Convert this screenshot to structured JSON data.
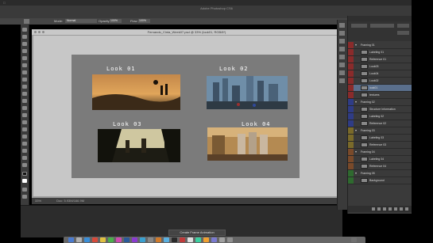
{
  "window_title": "Adobe Photoshop CS6",
  "document_tab": "Fernando_Cinta_Week07.psd @ 33% (look01, RGB/8*)",
  "options_bar": {
    "mode_label": "Mode:",
    "mode_value": "Normal",
    "opacity_label": "Opacity:",
    "opacity_value": "100%",
    "flow_label": "Flow:",
    "flow_value": "100%"
  },
  "status": {
    "zoom": "33%",
    "doc_size": "Doc: 5.93M/166.9M"
  },
  "artboard": {
    "looks": [
      "Look 01",
      "Look 02",
      "Look 03",
      "Look 04"
    ]
  },
  "panels": {
    "tabs": [
      "Layers",
      "Channels"
    ]
  },
  "layers": [
    {
      "name": "Framing 01",
      "group": true,
      "color": "#8a2b2b"
    },
    {
      "name": "Labeling 01",
      "group": false,
      "color": "#8a2b2b"
    },
    {
      "name": "Reference 01",
      "group": false,
      "color": "#8a2b2b"
    },
    {
      "name": "Look03",
      "group": false,
      "color": "#8a2b2b"
    },
    {
      "name": "Look04",
      "group": false,
      "color": "#8a2b2b"
    },
    {
      "name": "Look02",
      "group": false,
      "color": "#8a2b2b"
    },
    {
      "name": "look01",
      "group": false,
      "color": "#8a2b2b",
      "selected": true
    },
    {
      "name": "textures",
      "group": false,
      "color": "#8a2b2b"
    },
    {
      "name": "Framing 02",
      "group": true,
      "color": "#2f3c86"
    },
    {
      "name": "Structure Information",
      "group": false,
      "color": "#2f3c86"
    },
    {
      "name": "Labeling 02",
      "group": false,
      "color": "#2f3c86"
    },
    {
      "name": "Reference 02",
      "group": false,
      "color": "#2f3c86"
    },
    {
      "name": "Framing 03",
      "group": true,
      "color": "#7a6a2a"
    },
    {
      "name": "Labeling 03",
      "group": false,
      "color": "#7a6a2a"
    },
    {
      "name": "Reference 03",
      "group": false,
      "color": "#7a6a2a"
    },
    {
      "name": "Framing 04",
      "group": true,
      "color": "#7a4a2a"
    },
    {
      "name": "Labeling 04",
      "group": false,
      "color": "#7a4a2a"
    },
    {
      "name": "Reference 04",
      "group": false,
      "color": "#7a4a2a"
    },
    {
      "name": "Framing 05",
      "group": true,
      "color": "#2f6a2f"
    },
    {
      "name": "Background",
      "group": false,
      "color": "#2f6a2f"
    }
  ],
  "timeline": {
    "button_label": "Create Frame Animation"
  }
}
